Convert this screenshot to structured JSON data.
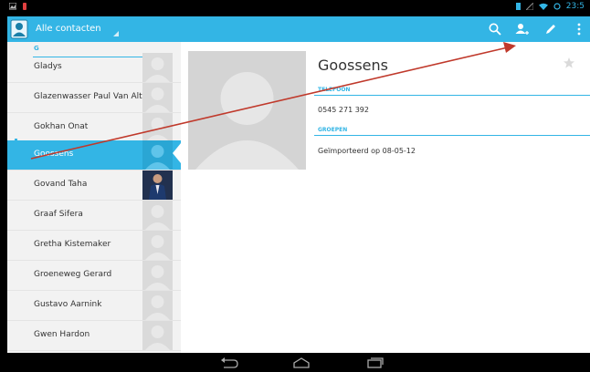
{
  "action_bar": {
    "title": "Alle contacten"
  },
  "status_bar": {
    "time": "23:5"
  },
  "contact_list": {
    "section_letter": "G",
    "items": [
      {
        "name": "Gladys"
      },
      {
        "name": "Glazenwasser Paul Van Alt"
      },
      {
        "name": "Gokhan Onat"
      },
      {
        "name": "Goossens"
      },
      {
        "name": "Govand Taha"
      },
      {
        "name": "Graaf Sifera"
      },
      {
        "name": "Gretha Kistemaker"
      },
      {
        "name": "Groeneweg Gerard"
      },
      {
        "name": "Gustavo Aarnink"
      },
      {
        "name": "Gwen Hardon"
      }
    ],
    "selected_index": 3
  },
  "detail": {
    "name": "Goossens",
    "phone_label": "TELEFOON",
    "phone": "0545 271 392",
    "groups_label": "GROEPEN",
    "group": "Geïmporteerd op 08-05-12"
  },
  "colors": {
    "accent": "#33b5e5",
    "annotation": "#c0392b"
  },
  "icons": [
    "search-icon",
    "add-contact-icon",
    "edit-icon",
    "overflow-menu-icon",
    "star-icon",
    "back-icon",
    "home-icon",
    "recent-apps-icon"
  ]
}
